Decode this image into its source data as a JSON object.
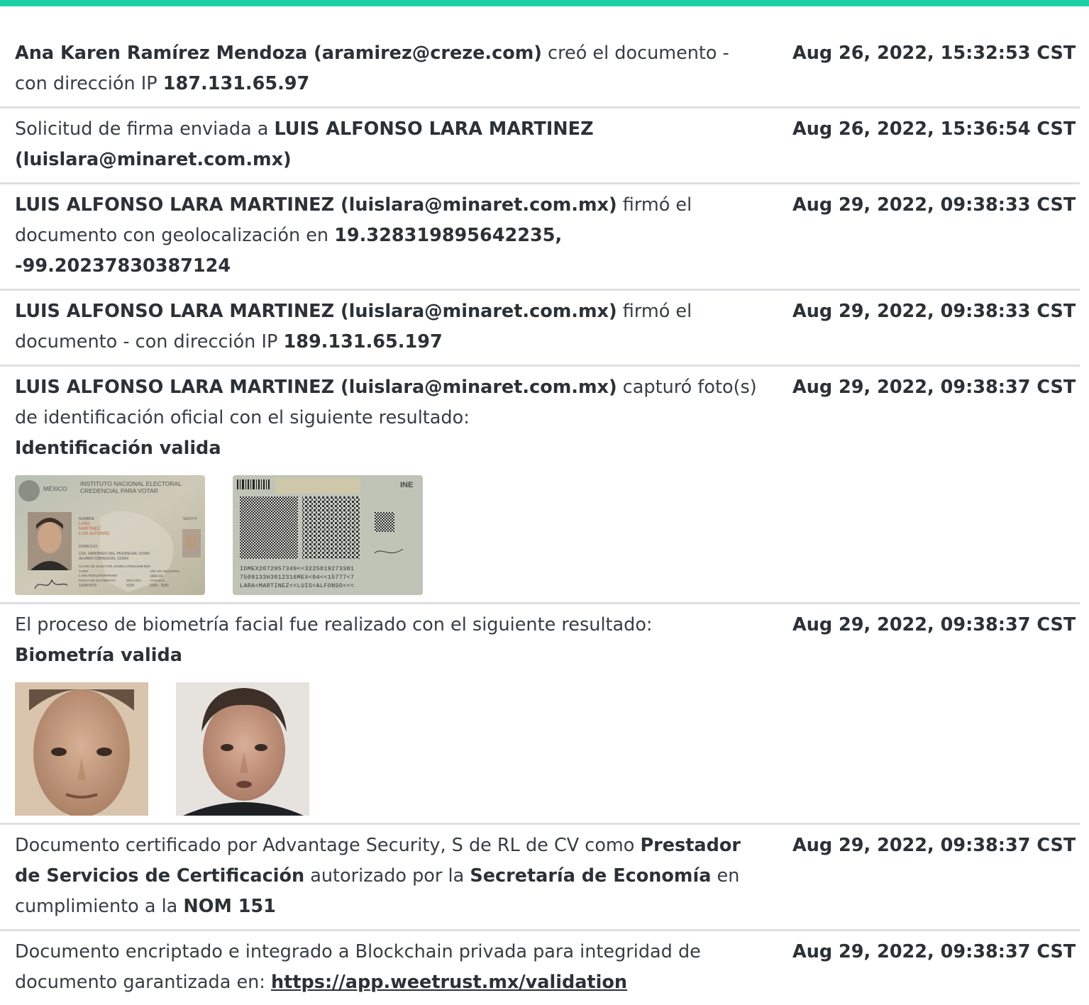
{
  "brand": {
    "accent": "#1ed1a5"
  },
  "events": [
    {
      "p": [
        {
          "t": "Ana Karen Ramírez Mendoza (aramirez@creze.com)",
          "b": true
        },
        {
          "t": " creó el documento - con dirección IP "
        },
        {
          "t": "187.131.65.97",
          "b": true
        }
      ],
      "timestamp": "Aug 26, 2022, 15:32:53 CST"
    },
    {
      "p": [
        {
          "t": "Solicitud de firma enviada a "
        },
        {
          "t": "LUIS ALFONSO LARA MARTINEZ (luislara@minaret.com.mx)",
          "b": true
        }
      ],
      "timestamp": "Aug 26, 2022, 15:36:54 CST"
    },
    {
      "p": [
        {
          "t": "LUIS ALFONSO LARA MARTINEZ (luislara@minaret.com.mx)",
          "b": true
        },
        {
          "t": " firmó el documento con geolocalización en "
        },
        {
          "t": "19.328319895642235, -99.20237830387124",
          "b": true
        }
      ],
      "timestamp": "Aug 29, 2022, 09:38:33 CST"
    },
    {
      "p": [
        {
          "t": "LUIS ALFONSO LARA MARTINEZ (luislara@minaret.com.mx)",
          "b": true
        },
        {
          "t": " firmó el documento - con dirección IP "
        },
        {
          "t": "189.131.65.197",
          "b": true
        }
      ],
      "timestamp": "Aug 29, 2022, 09:38:33 CST"
    },
    {
      "p": [
        {
          "t": "LUIS ALFONSO LARA MARTINEZ (luislara@minaret.com.mx)",
          "b": true
        },
        {
          "t": " capturó foto(s) de identificación oficial con el siguiente resultado:"
        },
        {
          "br": true
        },
        {
          "t": "Identificación valida",
          "b": true
        }
      ],
      "timestamp": "Aug 29, 2022, 09:38:37 CST",
      "images": "id"
    },
    {
      "p": [
        {
          "t": "El proceso de biometría facial fue realizado con el siguiente resultado:"
        },
        {
          "br": true
        },
        {
          "t": "Biometría valida",
          "b": true
        }
      ],
      "timestamp": "Aug 29, 2022, 09:38:37 CST",
      "images": "faces"
    },
    {
      "p": [
        {
          "t": "Documento certificado por Advantage Security, S de RL de CV como "
        },
        {
          "t": "Prestador de Servicios de Certificación",
          "b": true
        },
        {
          "t": " autorizado por la "
        },
        {
          "t": "Secretaría de Economía",
          "b": true
        },
        {
          "t": " en cumplimiento a la "
        },
        {
          "t": "NOM 151",
          "b": true
        }
      ],
      "timestamp": "Aug 29, 2022, 09:38:37 CST"
    },
    {
      "p": [
        {
          "t": "Documento encriptado e integrado a Blockchain privada para integridad de documento garantizada en: "
        },
        {
          "t": "https://app.weetrust.mx/validation",
          "link": true
        }
      ],
      "timestamp": "Aug 29, 2022, 09:38:37 CST",
      "last": true
    }
  ],
  "id_card_front": {
    "country": "MÉXICO",
    "institute": "INSTITUTO NACIONAL ELECTORAL",
    "card_type": "CREDENCIAL PARA VOTAR",
    "name_label": "NOMBRE",
    "name_lines": [
      "LARA",
      "MARTINEZ",
      "LUIS ALFONSO"
    ],
    "sex_label": "SEXO H",
    "address_label": "DOMICILIO",
    "address_lines": [
      "COL JARDINES DEL PEDREGAL 01900",
      "ALVARO OBREGON, CDMX"
    ],
    "elector_key": "CLAVE DE ELECTOR LRMRLS75091309H800",
    "curp": "CURP",
    "curp_value": "LAML750913HDFRRS00",
    "birth_label": "FECHA DE NACIMIENTO",
    "birth_value": "13/09/1975",
    "registry_label": "AÑO DE REGISTRO",
    "registry_value": "1994 04",
    "section_label": "SECCIÓN",
    "section_value": "3225",
    "validity_label": "VIGENCIA",
    "validity_value": "2020 - 2030"
  },
  "id_card_back": {
    "logo": "INE",
    "mrz_lines": [
      "IDMEX2072957349<<3225019273381",
      "7509133H3012316MEX<04<<15777<7",
      "LARA<MARTINEZ<<LUIS<ALFONSO<<<"
    ]
  }
}
